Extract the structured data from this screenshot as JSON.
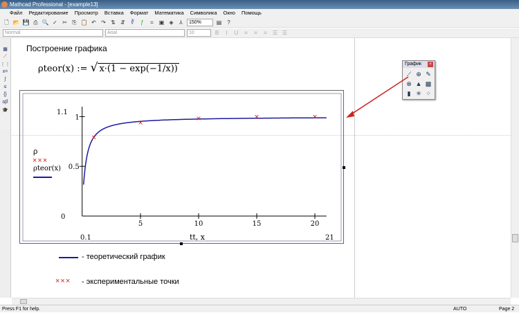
{
  "window": {
    "title": "Mathcad Professional - [example13]"
  },
  "menu": [
    "Файл",
    "Редактирование",
    "Просмотр",
    "Вставка",
    "Формат",
    "Математика",
    "Символика",
    "Окно",
    "Помощь"
  ],
  "toolbar": {
    "zoom": "150%"
  },
  "format_bar": {
    "style": "Normal",
    "font": "Arial",
    "size": "10"
  },
  "doc": {
    "heading": "Построение графика",
    "formula_lhs": "ρteor(x) :=",
    "formula_rhs": "x·(1 − exp(−1/x))"
  },
  "palette": {
    "title": "График",
    "icons": [
      "xy-plot-icon",
      "zoom-icon",
      "trace-icon",
      "polar-plot-icon",
      "surface-plot-icon",
      "contour-plot-icon",
      "bar3d-plot-icon",
      "scatter3d-plot-icon",
      "vector-field-icon"
    ]
  },
  "chart_data": {
    "type": "line",
    "xlabel": "tt, x",
    "ylabel_series": [
      "ρ",
      "ρteor(x)"
    ],
    "xlim": [
      0.1,
      21
    ],
    "ylim": [
      0,
      1.1
    ],
    "x_limit_labels": [
      "0.1",
      "21"
    ],
    "y_limit_labels": [
      "0",
      "1.1"
    ],
    "x_ticks": [
      5,
      10,
      15,
      20
    ],
    "y_ticks": [
      0.5,
      1
    ],
    "series": [
      {
        "name": "ρ",
        "style": "markers-x",
        "color": "#cc2222",
        "x": [
          1,
          5,
          10,
          15,
          20
        ],
        "y": [
          0.79,
          0.94,
          0.98,
          1.0,
          1.0
        ]
      },
      {
        "name": "ρteor(x)",
        "style": "line",
        "color": "#1a1aa0",
        "formula": "sqrt(x*(1-exp(-1/x)))"
      }
    ]
  },
  "legend_notes": {
    "theory": "- теоретический график",
    "experiment": "- экспериментальные точки"
  },
  "status": {
    "help": "Press F1 for help.",
    "mode": "AUTO",
    "page": "Page 2"
  }
}
